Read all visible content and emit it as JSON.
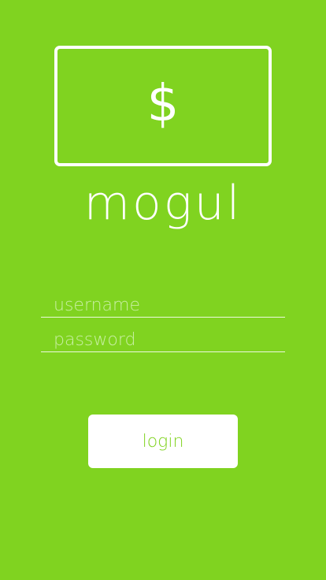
{
  "colors": {
    "background": "#80d320",
    "foreground": "#ffffff",
    "placeholder": "#c8efa3",
    "button_text": "#80d320"
  },
  "logo": {
    "icon": "dollar-sign-icon",
    "symbol": "$"
  },
  "app": {
    "name": "mogul"
  },
  "form": {
    "username": {
      "placeholder": "username",
      "value": ""
    },
    "password": {
      "placeholder": "password",
      "value": ""
    },
    "login_label": "login"
  }
}
